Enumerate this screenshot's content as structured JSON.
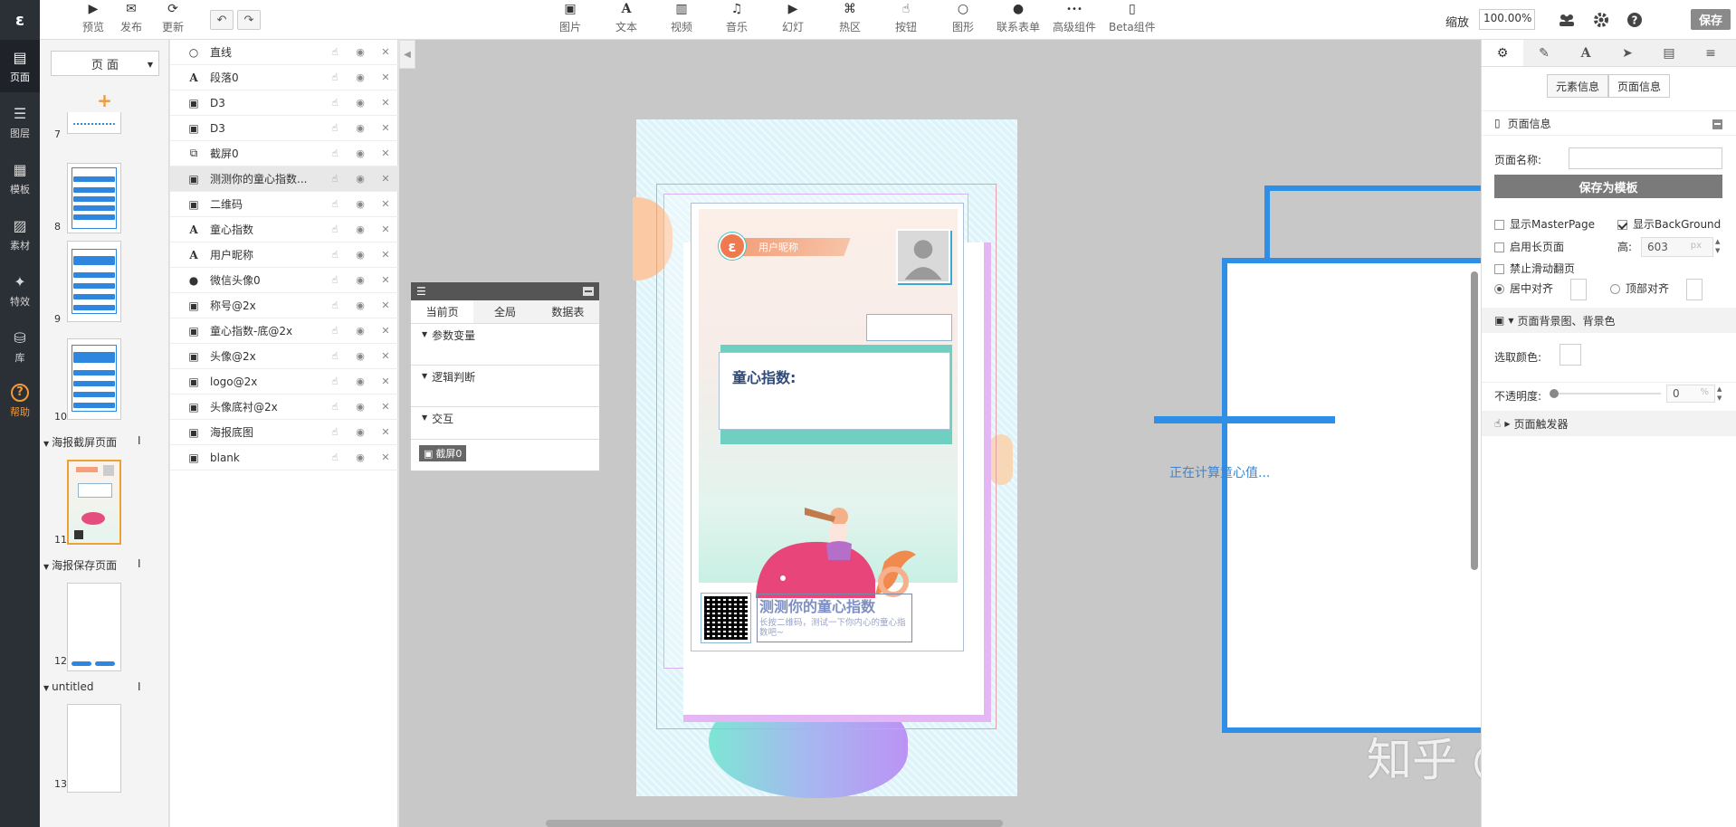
{
  "rail": {
    "logo": "ε",
    "items": [
      {
        "label": "页面",
        "icon": "page-icon",
        "glyph": "▤"
      },
      {
        "label": "图层",
        "icon": "layers-icon",
        "glyph": "☰"
      },
      {
        "label": "模板",
        "icon": "template-icon",
        "glyph": "▦"
      },
      {
        "label": "素材",
        "icon": "material-icon",
        "glyph": "▨"
      },
      {
        "label": "特效",
        "icon": "effect-icon",
        "glyph": "✦"
      },
      {
        "label": "库",
        "icon": "library-icon",
        "glyph": "⛁"
      },
      {
        "label": "帮助",
        "icon": "help-icon",
        "glyph": "?"
      }
    ]
  },
  "toolbar": {
    "left": [
      {
        "label": "预览",
        "icon": "preview-icon",
        "glyph": "▶"
      },
      {
        "label": "发布",
        "icon": "publish-icon",
        "glyph": "✉"
      },
      {
        "label": "更新",
        "icon": "update-icon",
        "glyph": "⟳"
      }
    ],
    "undo": "↶",
    "redo": "↷",
    "tools": [
      {
        "label": "图片",
        "icon": "image-icon",
        "glyph": "▣"
      },
      {
        "label": "文本",
        "icon": "text-icon",
        "glyph": "A"
      },
      {
        "label": "视频",
        "icon": "video-icon",
        "glyph": "▥"
      },
      {
        "label": "音乐",
        "icon": "music-icon",
        "glyph": "♫"
      },
      {
        "label": "幻灯",
        "icon": "slideshow-icon",
        "glyph": "▶"
      },
      {
        "label": "热区",
        "icon": "hotspot-icon",
        "glyph": "⌘"
      },
      {
        "label": "按钮",
        "icon": "button-icon",
        "glyph": "☝"
      },
      {
        "label": "图形",
        "icon": "shape-icon",
        "glyph": "○"
      },
      {
        "label": "联系表单",
        "icon": "contact-form-icon",
        "glyph": "●"
      },
      {
        "label": "高级组件",
        "icon": "advanced-icon",
        "glyph": "•••"
      },
      {
        "label": "Beta组件",
        "icon": "beta-icon",
        "glyph": "▯"
      }
    ],
    "zoom_label": "缩放",
    "zoom_value": "100.00%",
    "save": "保存"
  },
  "pages_panel": {
    "select": "页 面",
    "add": "+",
    "thumbs": [
      "7",
      "8",
      "9",
      "10",
      "11",
      "12",
      "13"
    ],
    "groups": [
      "海报截屏页面",
      "海报保存页面",
      "untitled"
    ]
  },
  "layers": [
    {
      "name": "直线",
      "type": "circle"
    },
    {
      "name": "段落0",
      "type": "text"
    },
    {
      "name": "D3",
      "type": "image"
    },
    {
      "name": "D3",
      "type": "image"
    },
    {
      "name": "截屏0",
      "type": "screenshot"
    },
    {
      "name": "测测你的童心指数...",
      "type": "image"
    },
    {
      "name": "二维码",
      "type": "image"
    },
    {
      "name": "童心指数",
      "type": "text"
    },
    {
      "name": "用户昵称",
      "type": "text"
    },
    {
      "name": "微信头像0",
      "type": "user"
    },
    {
      "name": "称号@2x",
      "type": "image"
    },
    {
      "name": "童心指数-底@2x",
      "type": "image"
    },
    {
      "name": "头像@2x",
      "type": "image"
    },
    {
      "name": "logo@2x",
      "type": "image"
    },
    {
      "name": "头像底衬@2x",
      "type": "image"
    },
    {
      "name": "海报底图",
      "type": "image"
    },
    {
      "name": "blank",
      "type": "image"
    }
  ],
  "interaction_panel": {
    "tabs": [
      "当前页",
      "全局",
      "数据表"
    ],
    "sections": [
      "参数变量",
      "逻辑判断",
      "交互"
    ],
    "badge": "截屏0"
  },
  "poster": {
    "brand_logo": "ε",
    "brand_text": "用户昵称",
    "score_label": "童心指数:",
    "title": "测测你的童心指数",
    "subtitle": "长按二维码，测试一下你内心的童心指数吧~"
  },
  "canvas": {
    "calc_text": "正在计算童心值...",
    "watermark": "知乎 @言之慎"
  },
  "props": {
    "seg": [
      "元素信息",
      "页面信息"
    ],
    "page_info_title": "页面信息",
    "page_name_label": "页面名称:",
    "save_template": "保存为模板",
    "show_masterpage": "显示MasterPage",
    "show_background": "显示BackGround",
    "long_page": "启用长页面",
    "height_label": "高:",
    "height_value": "603",
    "height_unit": "px",
    "no_swipe": "禁止滑动翻页",
    "center_align": "居中对齐",
    "top_align": "顶部对齐",
    "bg_section": "页面背景图、背景色",
    "pick_color": "选取颜色:",
    "opacity_label": "不透明度:",
    "opacity_value": "0",
    "opacity_unit": "%",
    "trigger_section": "页面触发器"
  },
  "colors": {
    "accent_blue": "#2f8ee5",
    "help_orange": "#f09a3a",
    "rail_bg": "#2b2f36"
  }
}
